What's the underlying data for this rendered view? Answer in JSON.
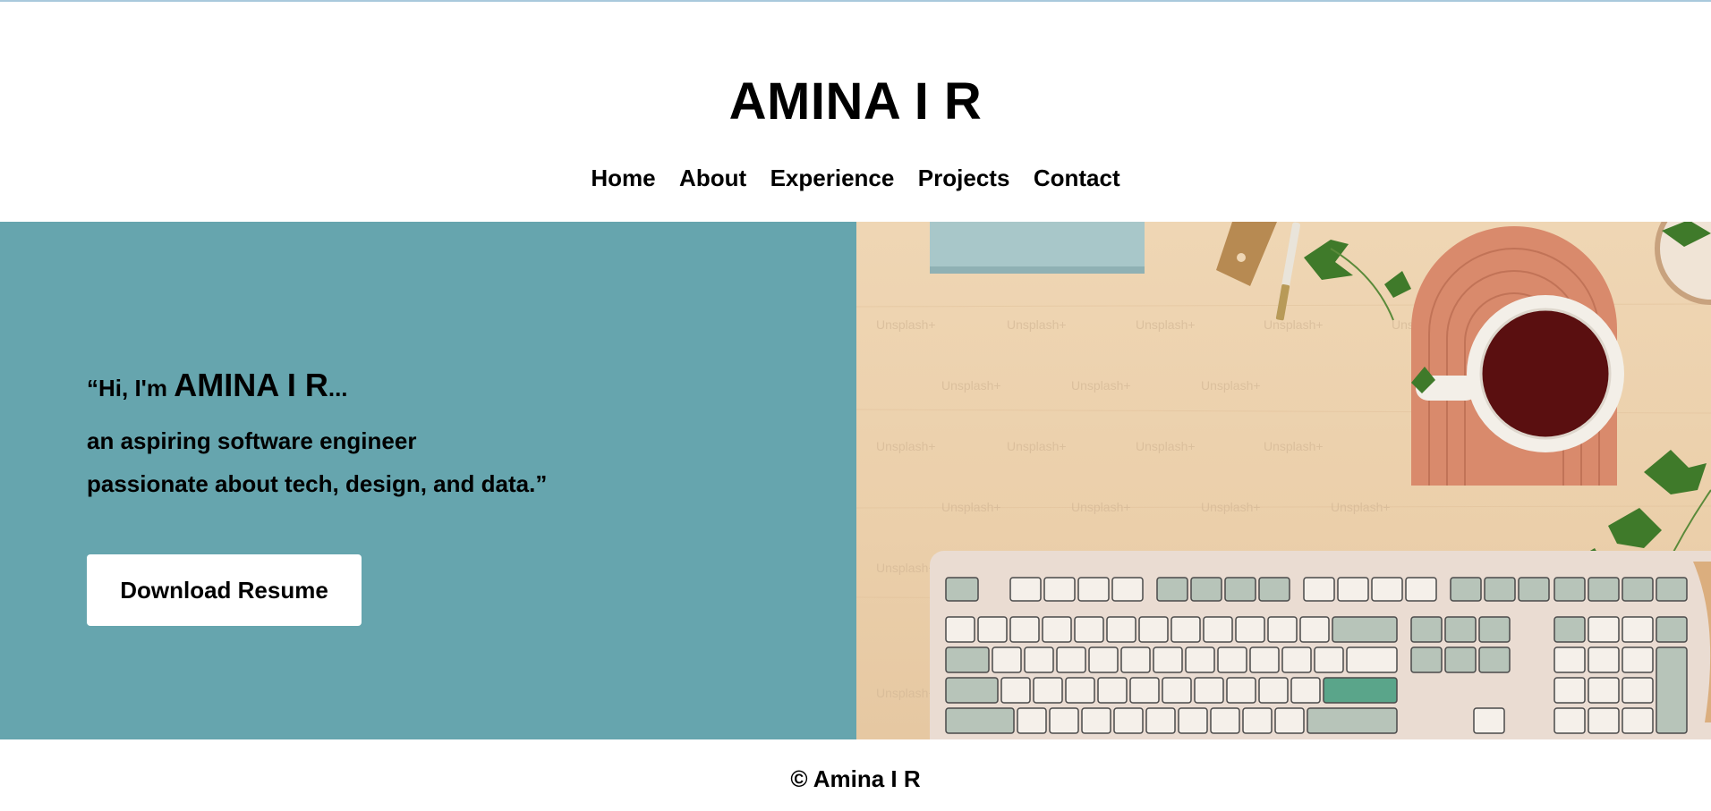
{
  "site": {
    "title": "AMINA I R"
  },
  "nav": {
    "items": [
      "Home",
      "About",
      "Experience",
      "Projects",
      "Contact"
    ]
  },
  "hero": {
    "greeting_prefix": "“Hi, I'm ",
    "greeting_name": "AMINA I R",
    "greeting_suffix": "...",
    "tagline_1": "an aspiring software engineer",
    "tagline_2": "passionate about tech, design, and data.”",
    "button_label": "Download Resume",
    "image_watermark": "Unsplash+",
    "colors": {
      "panel": "#66a5ae",
      "button_bg": "#ffffff"
    }
  },
  "footer": {
    "copyright": "© Amina I R"
  }
}
